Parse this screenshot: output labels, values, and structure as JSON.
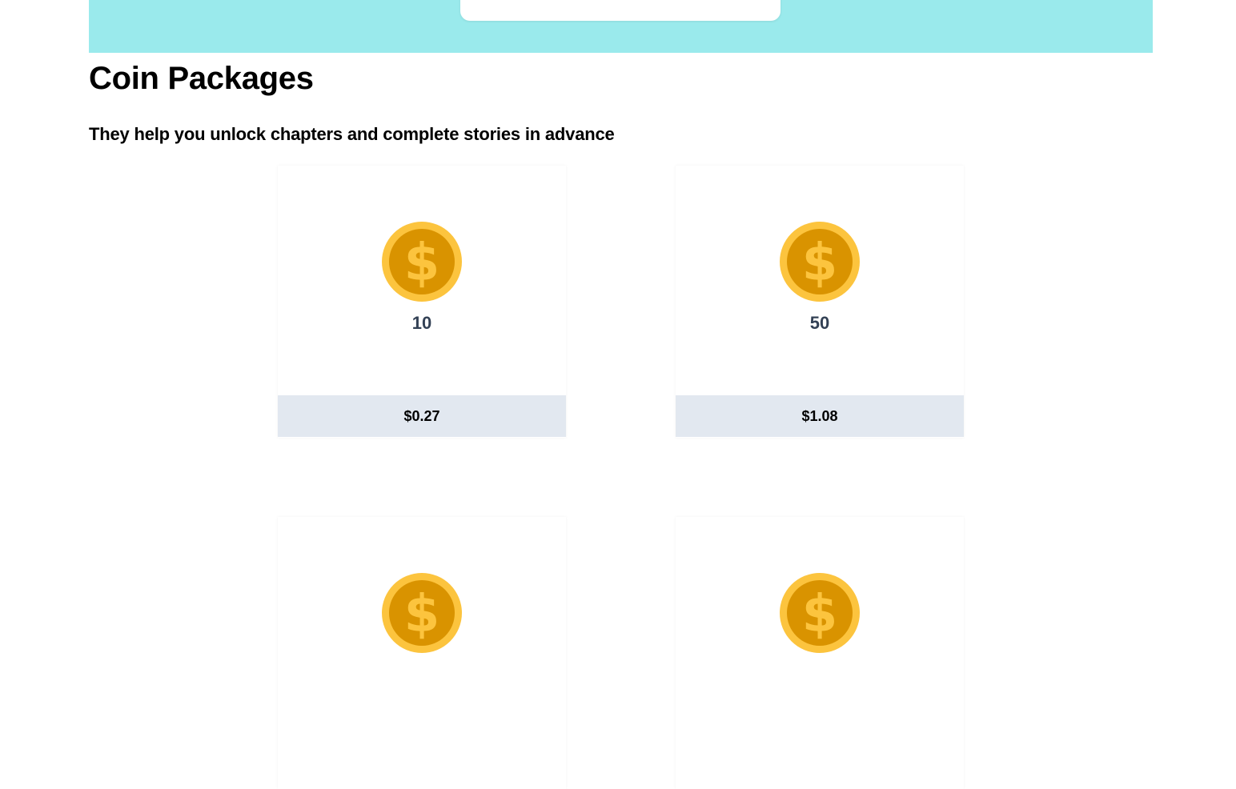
{
  "header": {
    "banner_color": "#9aeaec"
  },
  "page": {
    "title": "Coin Packages",
    "subtitle": "They help you unlock chapters and complete stories in advance"
  },
  "colors": {
    "coin_outer": "#fcc43e",
    "coin_inner": "#d99300",
    "price_bar_bg": "#e2e8f0",
    "amount_text": "#334155"
  },
  "packages": [
    {
      "icon": "coin-dollar-icon",
      "coins": "10",
      "price": "$0.27"
    },
    {
      "icon": "coin-dollar-icon",
      "coins": "50",
      "price": "$1.08"
    },
    {
      "icon": "coin-dollar-icon",
      "coins": "",
      "price": ""
    },
    {
      "icon": "coin-dollar-icon",
      "coins": "",
      "price": ""
    }
  ]
}
